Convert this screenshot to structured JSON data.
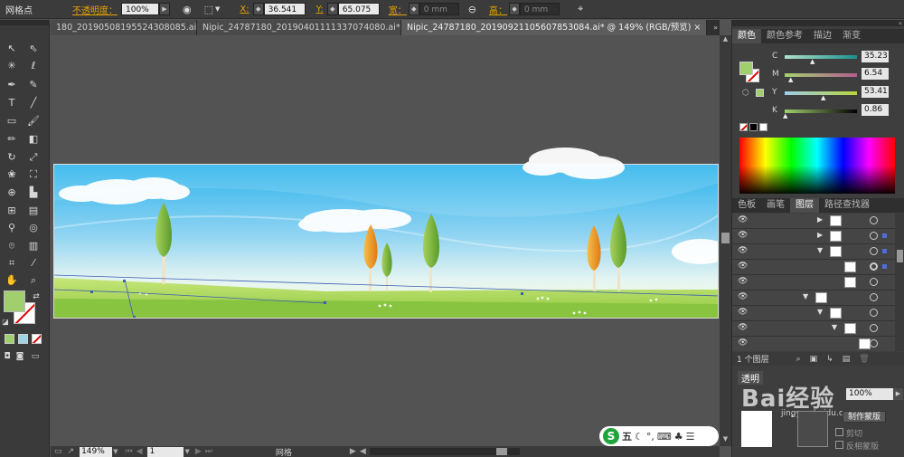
{
  "control_bar": {
    "mode_label": "网格点",
    "opacity_label": "不透明度：",
    "opacity_value": "100%",
    "x_label": "X:",
    "x_value": "36.541 m",
    "y_label": "Y:",
    "y_value": "65.075 m",
    "width_label": "宽：",
    "width_value": "0 mm",
    "height_label": "高：",
    "height_value": "0 mm"
  },
  "tabs": [
    {
      "label": "180_20190508195524308085.ai*",
      "close": "×"
    },
    {
      "label": "Nipic_24787180_20190401111337074080.ai*",
      "close": "×"
    },
    {
      "label": "Nipic_24787180_20190921105607853084.ai* @ 149% (RGB/预览)",
      "close": "×"
    }
  ],
  "color_panel": {
    "tabs": [
      "颜色",
      "颜色参考",
      "描边",
      "渐变"
    ],
    "channels": [
      {
        "name": "C",
        "value": "35.23"
      },
      {
        "name": "M",
        "value": "6.54"
      },
      {
        "name": "Y",
        "value": "53.41"
      },
      {
        "name": "K",
        "value": "0.86"
      }
    ],
    "fill_color": "#a2cf6e"
  },
  "layers_panel": {
    "tabs": [
      "色板",
      "画笔",
      "图层",
      "路径查找器"
    ],
    "footer": "1 个图层"
  },
  "bottom_panel": {
    "transparency_label": "透明",
    "opacity_value": "100%",
    "mask_button": "制作蒙版",
    "clip_label": "剪切",
    "invert_label": "反相蒙版",
    "watermark": "Bai经验",
    "watermark_sub": "jingyan.baidu.com"
  },
  "status_bar": {
    "zoom": "149%",
    "page": "1",
    "label": "网格"
  },
  "ime": {
    "logo": "S",
    "label": "五"
  }
}
